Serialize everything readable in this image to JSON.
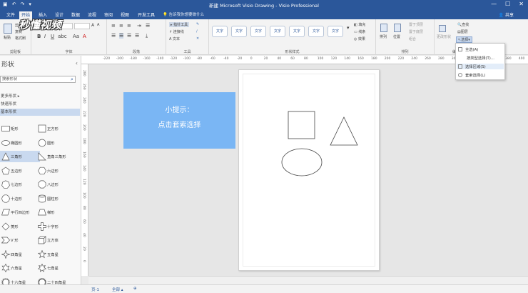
{
  "window": {
    "title": "新建 Microsoft Visio Drawing - Visio Professional",
    "controls": [
      "—",
      "☐",
      "✕"
    ]
  },
  "tabs": [
    "文件",
    "开始",
    "插入",
    "设计",
    "数据",
    "流程",
    "审阅",
    "视图",
    "开发工具"
  ],
  "active_tab": "开始",
  "tell_me": "告诉我你想要做什么",
  "share": "共享",
  "watermark": "秒懂视频",
  "ribbon": {
    "groups": {
      "clipboard": "剪贴板",
      "font": "字体",
      "paragraph": "段落",
      "tools": "工具",
      "shape_styles": "形状样式",
      "arrange": "排列",
      "editing": "编辑"
    },
    "clipboard": {
      "paste": "粘贴",
      "cut": "剪切",
      "copy": "复制",
      "format_painter": "格式刷"
    },
    "tools": {
      "pointer": "指针工具",
      "connector": "连接线",
      "text": "文本"
    },
    "style_label": "文字",
    "shape_fmt": {
      "fill": "填充",
      "line": "线条",
      "effects": "效果"
    },
    "arrange": {
      "align": "排列",
      "position": "位置",
      "group": "组合",
      "bring_forward": "置于顶层",
      "send_backward": "置于底层"
    },
    "edit": {
      "find": "查找",
      "layers": "图层",
      "select": "选择",
      "change_shape": "更改形状"
    }
  },
  "select_menu": {
    "items": [
      "全选(A)",
      "按类型选择(T)...",
      "选择区域(S)",
      "套索选择(L)"
    ],
    "highlighted": 2
  },
  "shapes_panel": {
    "title": "形状",
    "search_placeholder": "搜索形状",
    "categories": [
      "更多形状",
      "快速形状",
      "基本形状"
    ],
    "selected_category": "基本形状",
    "items": [
      [
        "矩形",
        "正方形"
      ],
      [
        "椭圆形",
        "圆形"
      ],
      [
        "三角形",
        "直角三角形"
      ],
      [
        "五边形",
        "六边形"
      ],
      [
        "七边形",
        "八边形"
      ],
      [
        "十边形",
        "圆柱形"
      ],
      [
        "平行四边形",
        "梯形"
      ],
      [
        "菱形",
        "十字形"
      ],
      [
        "V 形",
        "立方体"
      ],
      [
        "四角星",
        "五角星"
      ],
      [
        "六角星",
        "七角星"
      ],
      [
        "十六角星",
        "二十四角星"
      ]
    ],
    "selected_item": "三角形"
  },
  "hruler_ticks": [
    "-220",
    "-200",
    "-180",
    "-160",
    "-140",
    "-120",
    "-100",
    "-80",
    "-60",
    "-40",
    "-20",
    "0",
    "20",
    "40",
    "60",
    "80",
    "100",
    "120",
    "140",
    "160",
    "180",
    "200",
    "220",
    "240",
    "260",
    "280",
    "300",
    "320",
    "340",
    "360",
    "380",
    "400"
  ],
  "vruler_ticks": [
    "280",
    "260",
    "240",
    "220",
    "200",
    "180",
    "160",
    "140",
    "120",
    "100",
    "80",
    "60",
    "40",
    "20",
    "0"
  ],
  "hint": {
    "line1": "小提示：",
    "line2": "点击套索选择"
  },
  "status": {
    "page": "页-1",
    "all": "全部 ▴",
    "add": "⊕"
  }
}
